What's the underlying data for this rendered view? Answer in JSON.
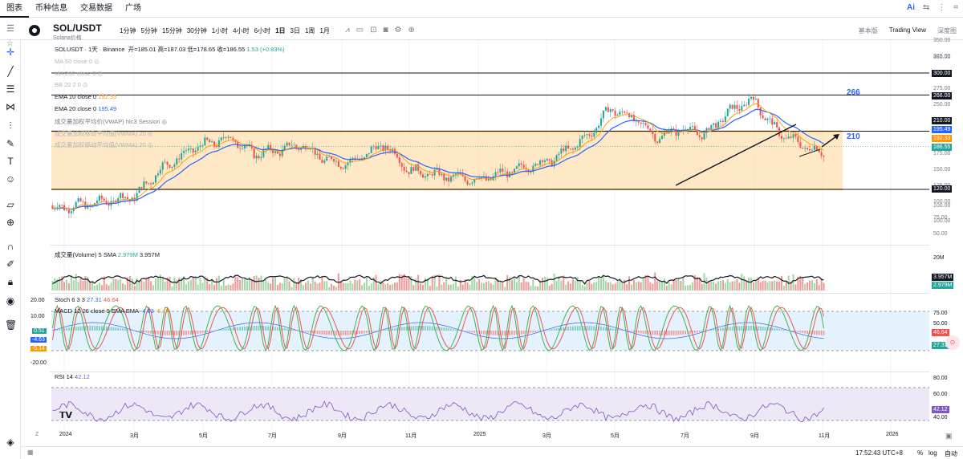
{
  "nav": {
    "tabs": [
      "图表",
      "币种信息",
      "交易数据",
      "广场"
    ],
    "right": [
      "Ai",
      "⇆",
      "⋮",
      "⌗"
    ]
  },
  "symbol": {
    "name": "SOL/USDT",
    "subtitle": "Solana价格"
  },
  "intervals": [
    "1分钟",
    "5分钟",
    "15分钟",
    "30分钟",
    "1小时",
    "4小时",
    "6小时",
    "1日",
    "3日",
    "1周",
    "1月"
  ],
  "selected_interval": "1日",
  "views": [
    "基本版",
    "Trading View",
    "深度图"
  ],
  "selected_view": "Trading View",
  "legend": {
    "title": "SOLUSDT · 1天 · Binance",
    "open": "开=185.01",
    "high": "高=187.03",
    "low": "低=178.65",
    "close": "收=186.55",
    "change": "1.53 (+0.83%)",
    "ma50": "MA 50 close 0",
    "ma200": "MA 200 close 0",
    "bb": "BB 20 2 0",
    "ema10": "EMA 10 close 0",
    "ema10_val": "192.33",
    "ema20": "EMA 20 close 0",
    "ema20_val": "195.49",
    "vwap": "成交量加权平均价(VWAP) hlc3 Session",
    "vwma1": "成交量加权移动平均值(VWMA) 20",
    "vwma2": "成交量加权移动平均值(VWMA) 20"
  },
  "price_axis": [
    "350.00",
    "325.00",
    "300.00",
    "275.00",
    "250.00",
    "225.00",
    "200.00",
    "175.00",
    "150.00",
    "125.00",
    "100.00",
    "75.00",
    "50.00"
  ],
  "levels": {
    "l300": "300.00",
    "l266": "266.00",
    "l210": "210.00",
    "l120": "120.00",
    "ema20_tag": "195.49",
    "ema10_tag": "192.33",
    "last": "186.55"
  },
  "annotations": {
    "a266": "266",
    "a210": "210"
  },
  "volume": {
    "label": "成交量(Volume)",
    "sma": "5 SMA",
    "v1": "2.979M",
    "v2": "3.957M",
    "axis": "20M",
    "tag1": "3.957M",
    "tag2": "2.979M"
  },
  "stoch": {
    "label": "Stoch 6 3 3",
    "k": "27.31",
    "d": "46.64",
    "tag_d": "46.64",
    "tag_k": "27.31",
    "axis": [
      "75.00",
      "50.00",
      "25.00"
    ]
  },
  "macd": {
    "label": "MACD 12 26 close 9 EMA EMA",
    "m1": "-4.63",
    "m2": "-5.14",
    "left_axis": [
      "20.00",
      "10.00",
      "0.51",
      "-4.63",
      "-5.14",
      "-20.00"
    ]
  },
  "rsi": {
    "label": "RSI 14",
    "value": "42.12",
    "axis": [
      "80.00",
      "60.00",
      "40.00"
    ],
    "tag": "42.12"
  },
  "x_axis": [
    "2024",
    "3月",
    "5月",
    "7月",
    "9月",
    "11月",
    "2025",
    "3月",
    "5月",
    "7月",
    "9月",
    "11月",
    "2026"
  ],
  "bottom": {
    "time": "17:52:43 UTC+8",
    "pct": "%",
    "log": "log",
    "auto": "自动"
  },
  "colors": {
    "up": "#26a69a",
    "down": "#ef5350",
    "ema20": "#2962ff",
    "ema10": "#ff9800",
    "zone": "#ffe0b2",
    "stoch_band": "#e3f2fd",
    "rsi_band": "#ede7f6"
  }
}
